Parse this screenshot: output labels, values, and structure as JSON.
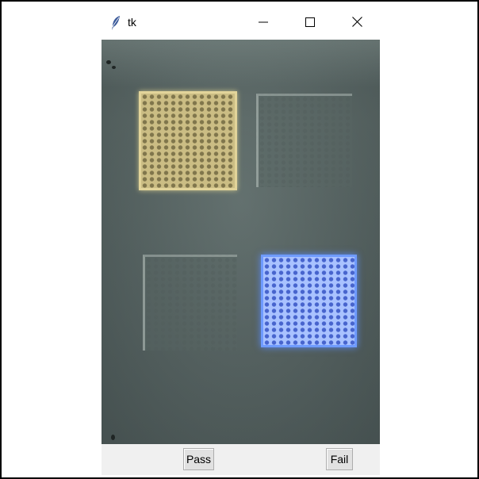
{
  "window": {
    "title": "tk",
    "app_icon": "feather-icon",
    "controls": {
      "minimize_icon": "minimize-icon",
      "maximize_icon": "maximize-icon",
      "close_icon": "close-icon"
    }
  },
  "photo": {
    "pads": [
      {
        "position": "top-left",
        "state": "lit",
        "color": "#cbbd84"
      },
      {
        "position": "top-right",
        "state": "unlit"
      },
      {
        "position": "bottom-left",
        "state": "unlit"
      },
      {
        "position": "bottom-right",
        "state": "lit",
        "color": "#6f9bff"
      }
    ]
  },
  "buttons": {
    "pass_label": "Pass",
    "fail_label": "Fail"
  }
}
